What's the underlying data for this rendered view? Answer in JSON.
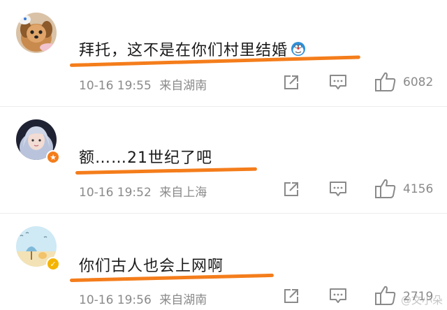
{
  "comments": [
    {
      "text": "拜托，这不是在你们村里结婚",
      "time": "10-16 19:55",
      "location": "来自湖南",
      "likes": "6082"
    },
    {
      "text": "额……21世纪了吧",
      "time": "10-16 19:52",
      "location": "来自上海",
      "likes": "4156"
    },
    {
      "text": "你们古人也会上网啊",
      "time": "10-16 19:56",
      "location": "来自湖南",
      "likes": "2719"
    }
  ],
  "watermark": "@文小朵",
  "colors": {
    "underline": "#f47d1b",
    "meta_text": "#8a8a8a",
    "badge_orange": "#f47d1b",
    "badge_yellow": "#f5b400"
  }
}
